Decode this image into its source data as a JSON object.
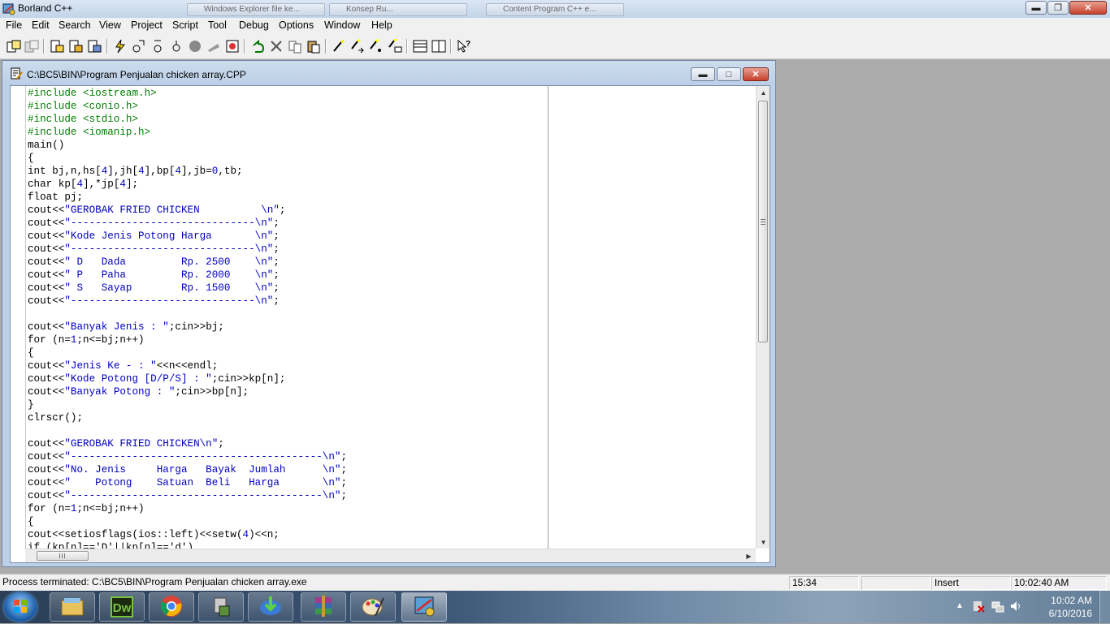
{
  "app": {
    "title": "Borland C++",
    "background_tabs": [
      "Windows Explorer file ke...",
      "Konsep Ru...",
      "Content Program C++ e..."
    ]
  },
  "menu": [
    "File",
    "Edit",
    "Search",
    "View",
    "Project",
    "Script",
    "Tool",
    "Debug",
    "Options",
    "Window",
    "Help"
  ],
  "toolbar": {
    "icons": [
      "open-project-icon",
      "close-project-icon",
      "new-file-icon",
      "open-file-icon",
      "save-file-icon",
      "lightning-icon",
      "compile-icon",
      "make-icon",
      "stop-icon",
      "step-icon",
      "debug-icon",
      "undo-icon",
      "cut-icon",
      "copy-icon",
      "paste-icon",
      "search-icon",
      "search-again-icon",
      "replace-icon",
      "browse-icon",
      "window-tile-icon",
      "window-cascade-icon",
      "help-icon"
    ]
  },
  "editor": {
    "title": "C:\\BC5\\BIN\\Program Penjualan chicken array.CPP",
    "lines": [
      [
        {
          "t": "#include <iostream.h>",
          "c": "pp"
        }
      ],
      [
        {
          "t": "#include <conio.h>",
          "c": "pp"
        }
      ],
      [
        {
          "t": "#include <stdio.h>",
          "c": "pp"
        }
      ],
      [
        {
          "t": "#include <iomanip.h>",
          "c": "pp"
        }
      ],
      [
        {
          "t": "main()"
        }
      ],
      [
        {
          "t": "{"
        }
      ],
      [
        {
          "t": "int bj,n,hs["
        },
        {
          "t": "4",
          "c": "nm"
        },
        {
          "t": "],jh["
        },
        {
          "t": "4",
          "c": "nm"
        },
        {
          "t": "],bp["
        },
        {
          "t": "4",
          "c": "nm"
        },
        {
          "t": "],jb="
        },
        {
          "t": "0",
          "c": "nm"
        },
        {
          "t": ",tb;"
        }
      ],
      [
        {
          "t": "char kp["
        },
        {
          "t": "4",
          "c": "nm"
        },
        {
          "t": "],*jp["
        },
        {
          "t": "4",
          "c": "nm"
        },
        {
          "t": "];"
        }
      ],
      [
        {
          "t": "float pj;"
        }
      ],
      [
        {
          "t": "cout<<"
        },
        {
          "t": "\"GEROBAK FRIED CHICKEN          \\n\"",
          "c": "st"
        },
        {
          "t": ";"
        }
      ],
      [
        {
          "t": "cout<<"
        },
        {
          "t": "\"------------------------------\\n\"",
          "c": "st"
        },
        {
          "t": ";"
        }
      ],
      [
        {
          "t": "cout<<"
        },
        {
          "t": "\"Kode Jenis Potong Harga       \\n\"",
          "c": "st"
        },
        {
          "t": ";"
        }
      ],
      [
        {
          "t": "cout<<"
        },
        {
          "t": "\"------------------------------\\n\"",
          "c": "st"
        },
        {
          "t": ";"
        }
      ],
      [
        {
          "t": "cout<<"
        },
        {
          "t": "\" D   Dada         Rp. 2500    \\n\"",
          "c": "st"
        },
        {
          "t": ";"
        }
      ],
      [
        {
          "t": "cout<<"
        },
        {
          "t": "\" P   Paha         Rp. 2000    \\n\"",
          "c": "st"
        },
        {
          "t": ";"
        }
      ],
      [
        {
          "t": "cout<<"
        },
        {
          "t": "\" S   Sayap        Rp. 1500    \\n\"",
          "c": "st"
        },
        {
          "t": ";"
        }
      ],
      [
        {
          "t": "cout<<"
        },
        {
          "t": "\"------------------------------\\n\"",
          "c": "st"
        },
        {
          "t": ";"
        }
      ],
      [
        {
          "t": ""
        }
      ],
      [
        {
          "t": "cout<<"
        },
        {
          "t": "\"Banyak Jenis : \"",
          "c": "st"
        },
        {
          "t": ";cin>>bj;"
        }
      ],
      [
        {
          "t": "for (n="
        },
        {
          "t": "1",
          "c": "nm"
        },
        {
          "t": ";n<=bj;n++)"
        }
      ],
      [
        {
          "t": "{"
        }
      ],
      [
        {
          "t": "cout<<"
        },
        {
          "t": "\"Jenis Ke - : \"",
          "c": "st"
        },
        {
          "t": "<<n<<endl;"
        }
      ],
      [
        {
          "t": "cout<<"
        },
        {
          "t": "\"Kode Potong [D/P/S] : \"",
          "c": "st"
        },
        {
          "t": ";cin>>kp[n];"
        }
      ],
      [
        {
          "t": "cout<<"
        },
        {
          "t": "\"Banyak Potong : \"",
          "c": "st"
        },
        {
          "t": ";cin>>bp[n];"
        }
      ],
      [
        {
          "t": "}"
        }
      ],
      [
        {
          "t": "clrscr();"
        }
      ],
      [
        {
          "t": ""
        }
      ],
      [
        {
          "t": "cout<<"
        },
        {
          "t": "\"GEROBAK FRIED CHICKEN\\n\"",
          "c": "st"
        },
        {
          "t": ";"
        }
      ],
      [
        {
          "t": "cout<<"
        },
        {
          "t": "\"-----------------------------------------\\n\"",
          "c": "st"
        },
        {
          "t": ";"
        }
      ],
      [
        {
          "t": "cout<<"
        },
        {
          "t": "\"No. Jenis     Harga   Bayak  Jumlah      \\n\"",
          "c": "st"
        },
        {
          "t": ";"
        }
      ],
      [
        {
          "t": "cout<<"
        },
        {
          "t": "\"    Potong    Satuan  Beli   Harga       \\n\"",
          "c": "st"
        },
        {
          "t": ";"
        }
      ],
      [
        {
          "t": "cout<<"
        },
        {
          "t": "\"-----------------------------------------\\n\"",
          "c": "st"
        },
        {
          "t": ";"
        }
      ],
      [
        {
          "t": "for (n="
        },
        {
          "t": "1",
          "c": "nm"
        },
        {
          "t": ";n<=bj;n++)"
        }
      ],
      [
        {
          "t": "{"
        }
      ],
      [
        {
          "t": "cout<<setiosflags(ios::left)<<setw("
        },
        {
          "t": "4",
          "c": "nm"
        },
        {
          "t": ")<<n;"
        }
      ],
      [
        {
          "t": "if (kp[n]=='D'||kp[n]=='d')"
        }
      ]
    ]
  },
  "status": {
    "message": "Process terminated: C:\\BC5\\BIN\\Program Penjualan chicken array.exe",
    "position": "15:34",
    "modified": "",
    "mode": "Insert",
    "time": "10:02:40 AM"
  },
  "taskbar": {
    "apps": [
      "explorer-icon",
      "dreamweaver-icon",
      "chrome-icon",
      "usb-tool-icon",
      "download-manager-icon",
      "winrar-icon",
      "paint-icon",
      "borland-icon"
    ],
    "dw_label": "Dw",
    "clock_time": "10:02 AM",
    "clock_date": "6/10/2016"
  },
  "colors": {
    "preprocessor": "#008000",
    "string": "#0000c0",
    "number": "#0000c0"
  }
}
